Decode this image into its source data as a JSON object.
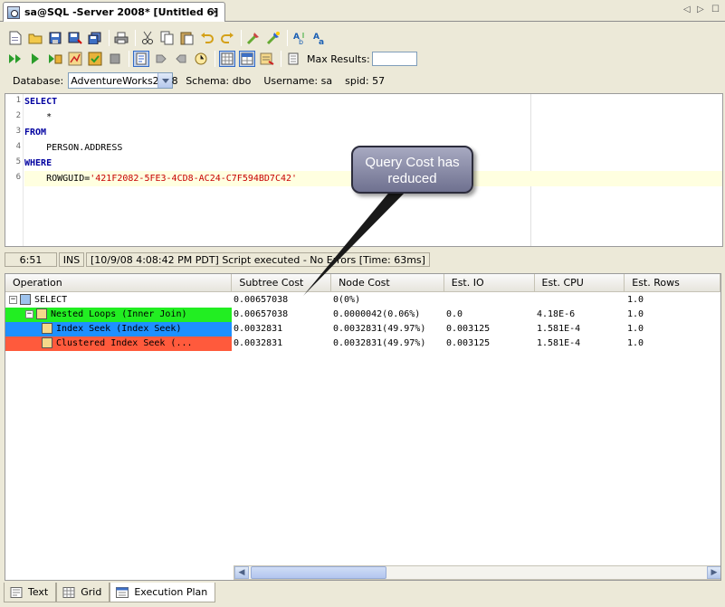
{
  "tab": {
    "title": "sa@SQL -Server 2008* [Untitled 6]",
    "close": "✕",
    "nav_left": "◁",
    "nav_right": "▷",
    "menu": "☐"
  },
  "toolbar": {
    "max_results_label": "Max Results:",
    "max_results_value": ""
  },
  "dbbar": {
    "database_label": "Database:",
    "database_value": "AdventureWorks2008",
    "schema_label": "Schema:",
    "schema_value": "dbo",
    "username_label": "Username:",
    "username_value": "sa",
    "spid_label": "spid:",
    "spid_value": "57"
  },
  "editor": {
    "lines": [
      {
        "num": "1",
        "text": "SELECT"
      },
      {
        "num": "2",
        "text": "    *"
      },
      {
        "num": "3",
        "text": "FROM"
      },
      {
        "num": "4",
        "text": "    PERSON.ADDRESS"
      },
      {
        "num": "5",
        "text": "WHERE"
      },
      {
        "num": "6",
        "prefix": "    ROWGUID=",
        "string": "'421F2082-5FE3-4CD8-AC24-C7F594BD7C42'"
      }
    ]
  },
  "status": {
    "position": "6:51",
    "mode": "INS",
    "message": "[10/9/08 4:08:42 PM PDT] Script executed - No Errors [Time: 63ms]"
  },
  "grid": {
    "headers": [
      "Operation",
      "Subtree Cost",
      "Node Cost",
      "Est. IO",
      "Est. CPU",
      "Est. Rows"
    ],
    "rows": [
      {
        "op": "SELECT",
        "subtree": "0.00657038",
        "node": "0(0%)",
        "io": "",
        "cpu": "",
        "rows": "1.0",
        "color": "#ffffff"
      },
      {
        "op": "Nested Loops (Inner Join)",
        "subtree": "0.00657038",
        "node": "0.0000042(0.06%)",
        "io": "0.0",
        "cpu": "4.18E-6",
        "rows": "1.0",
        "color": "#22ee22"
      },
      {
        "op": "Index Seek (Index Seek)",
        "subtree": "0.0032831",
        "node": "0.0032831(49.97%)",
        "io": "0.003125",
        "cpu": "1.581E-4",
        "rows": "1.0",
        "color": "#1e90ff"
      },
      {
        "op": "Clustered Index Seek (...",
        "subtree": "0.0032831",
        "node": "0.0032831(49.97%)",
        "io": "0.003125",
        "cpu": "1.581E-4",
        "rows": "1.0",
        "color": "#ff5a3c"
      }
    ]
  },
  "bottom_tabs": [
    "Text",
    "Grid",
    "Execution Plan"
  ],
  "callout": {
    "line1": "Query Cost has",
    "line2": "reduced"
  }
}
